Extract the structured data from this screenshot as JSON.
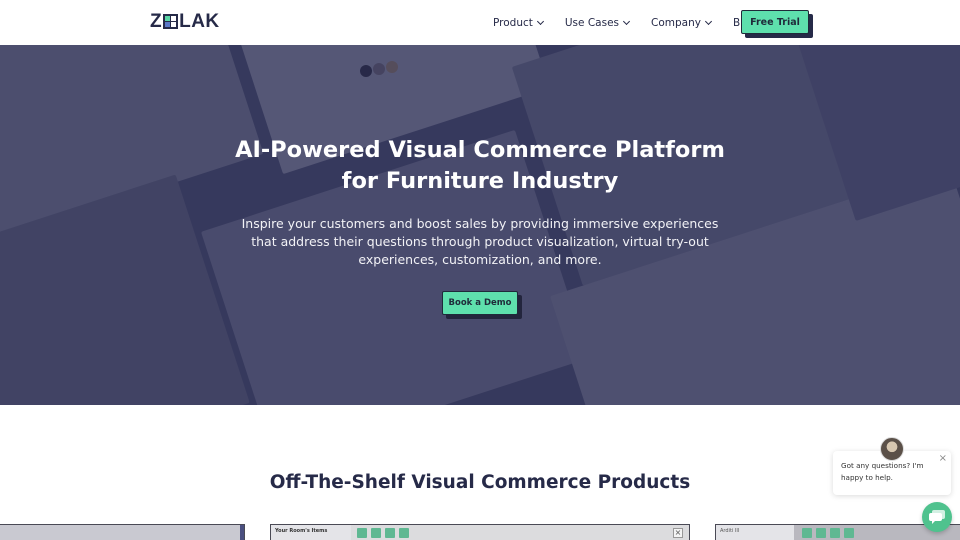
{
  "navbar": {
    "logo": {
      "prefix": "Z",
      "suffix": "LAK"
    },
    "links": [
      {
        "label": "Product",
        "has_dropdown": true
      },
      {
        "label": "Use Cases",
        "has_dropdown": true
      },
      {
        "label": "Company",
        "has_dropdown": true
      },
      {
        "label": "Blog",
        "has_dropdown": false
      }
    ],
    "cta_label": "Free Trial"
  },
  "hero": {
    "title_line1": "AI-Powered Visual Commerce Platform",
    "title_line2": "for Furniture Industry",
    "subtitle_line1": "Inspire your customers and boost sales by providing immersive experiences",
    "subtitle_line2": "that address their questions through product visualization, virtual try-out",
    "subtitle_line3": "experiences, customization, and more.",
    "cta_label": "Book a Demo"
  },
  "products_section": {
    "title": "Off-The-Shelf Visual Commerce Products",
    "cards": [
      {
        "panel_label": ""
      },
      {
        "panel_label": "Your Room's Items"
      },
      {
        "panel_label": "Arditi III"
      }
    ]
  },
  "chat": {
    "message": "Got any questions? I'm happy to help.",
    "close_icon": "close-icon",
    "launcher_icon": "chat-icon"
  },
  "colors": {
    "accent": "#5ee0ad",
    "navy": "#262a48",
    "chat_green": "#4fc28e"
  }
}
